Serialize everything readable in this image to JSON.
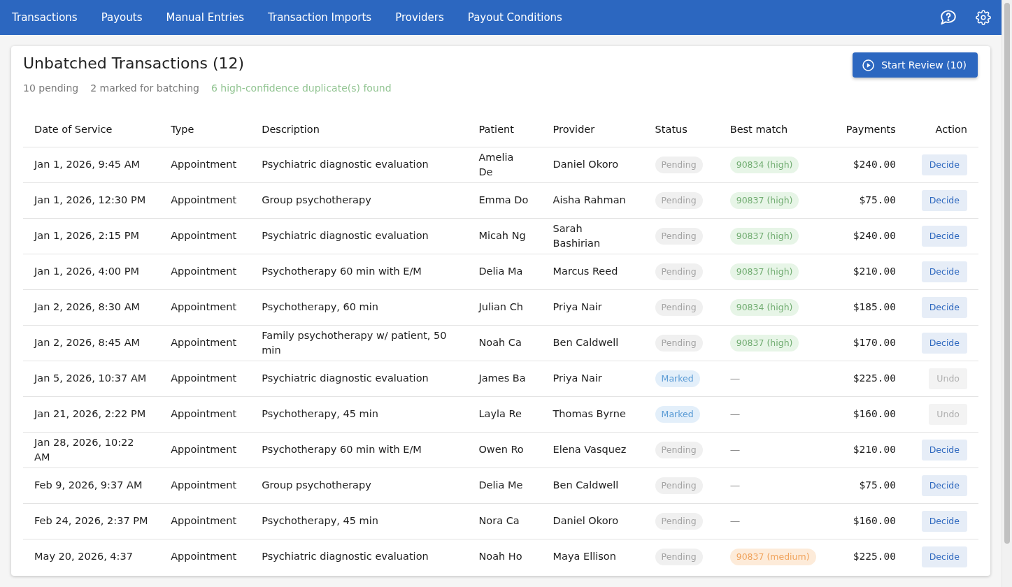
{
  "nav_links": [
    "Transactions",
    "Payouts",
    "Manual Entries",
    "Transaction Imports",
    "Providers",
    "Payout Conditions"
  ],
  "panel": {
    "title": "Unbatched Transactions (12)",
    "stats": [
      {
        "text": "10 pending",
        "kind": "muted"
      },
      {
        "text": "2 marked for batching",
        "kind": "muted"
      },
      {
        "text": "6 high-confidence duplicate(s) found",
        "kind": "success"
      }
    ],
    "review_button": "Start Review (10)"
  },
  "table": {
    "columns": [
      "Date of Service",
      "Type",
      "Description",
      "Patient",
      "Provider",
      "Status",
      "Best match",
      "Payments",
      "Action"
    ],
    "rows": [
      {
        "date_of_service": "Jan 1, 2026, 9:45 AM",
        "type": "Appointment",
        "description": "Psychiatric diagnostic evaluation",
        "patient": "Amelia De",
        "provider": "Daniel Okoro",
        "status": {
          "label": "Pending",
          "kind": "pending"
        },
        "best_match": {
          "label": "90834 (high)",
          "kind": "high"
        },
        "payments": "$240.00",
        "action": {
          "label": "Decide",
          "kind": "decide"
        }
      },
      {
        "date_of_service": "Jan 1, 2026, 12:30 PM",
        "type": "Appointment",
        "description": "Group psychotherapy",
        "patient": "Emma Do",
        "provider": "Aisha Rahman",
        "status": {
          "label": "Pending",
          "kind": "pending"
        },
        "best_match": {
          "label": "90837 (high)",
          "kind": "high"
        },
        "payments": "$75.00",
        "action": {
          "label": "Decide",
          "kind": "decide"
        }
      },
      {
        "date_of_service": "Jan 1, 2026, 2:15 PM",
        "type": "Appointment",
        "description": "Psychiatric diagnostic evaluation",
        "patient": "Micah Ng",
        "provider": "Sarah Bashirian",
        "status": {
          "label": "Pending",
          "kind": "pending"
        },
        "best_match": {
          "label": "90837 (high)",
          "kind": "high"
        },
        "payments": "$240.00",
        "action": {
          "label": "Decide",
          "kind": "decide"
        }
      },
      {
        "date_of_service": "Jan 1, 2026, 4:00 PM",
        "type": "Appointment",
        "description": "Psychotherapy 60 min with E/M",
        "patient": "Delia Ma",
        "provider": "Marcus Reed",
        "status": {
          "label": "Pending",
          "kind": "pending"
        },
        "best_match": {
          "label": "90837 (high)",
          "kind": "high"
        },
        "payments": "$210.00",
        "action": {
          "label": "Decide",
          "kind": "decide"
        }
      },
      {
        "date_of_service": "Jan 2, 2026, 8:30 AM",
        "type": "Appointment",
        "description": "Psychotherapy, 60 min",
        "patient": "Julian Ch",
        "provider": "Priya Nair",
        "status": {
          "label": "Pending",
          "kind": "pending"
        },
        "best_match": {
          "label": "90834 (high)",
          "kind": "high"
        },
        "payments": "$185.00",
        "action": {
          "label": "Decide",
          "kind": "decide"
        }
      },
      {
        "date_of_service": "Jan 2, 2026, 8:45 AM",
        "type": "Appointment",
        "description": "Family psychotherapy w/ patient, 50 min",
        "patient": "Noah Ca",
        "provider": "Ben Caldwell",
        "status": {
          "label": "Pending",
          "kind": "pending"
        },
        "best_match": {
          "label": "90837 (high)",
          "kind": "high"
        },
        "payments": "$170.00",
        "action": {
          "label": "Decide",
          "kind": "decide"
        }
      },
      {
        "date_of_service": "Jan 5, 2026, 10:37 AM",
        "type": "Appointment",
        "description": "Psychiatric diagnostic evaluation",
        "patient": "James Ba",
        "provider": "Priya Nair",
        "status": {
          "label": "Marked",
          "kind": "marked"
        },
        "best_match": {
          "label": "—",
          "kind": "none"
        },
        "payments": "$225.00",
        "action": {
          "label": "Undo",
          "kind": "undo"
        }
      },
      {
        "date_of_service": "Jan 21, 2026, 2:22 PM",
        "type": "Appointment",
        "description": "Psychotherapy, 45 min",
        "patient": "Layla Re",
        "provider": "Thomas Byrne",
        "status": {
          "label": "Marked",
          "kind": "marked"
        },
        "best_match": {
          "label": "—",
          "kind": "none"
        },
        "payments": "$160.00",
        "action": {
          "label": "Undo",
          "kind": "undo"
        }
      },
      {
        "date_of_service": "Jan 28, 2026, 10:22 AM",
        "type": "Appointment",
        "description": "Psychotherapy 60 min with E/M",
        "patient": "Owen Ro",
        "provider": "Elena Vasquez",
        "status": {
          "label": "Pending",
          "kind": "pending"
        },
        "best_match": {
          "label": "—",
          "kind": "none"
        },
        "payments": "$210.00",
        "action": {
          "label": "Decide",
          "kind": "decide"
        }
      },
      {
        "date_of_service": "Feb 9, 2026, 9:37 AM",
        "type": "Appointment",
        "description": "Group psychotherapy",
        "patient": "Delia Me",
        "provider": "Ben Caldwell",
        "status": {
          "label": "Pending",
          "kind": "pending"
        },
        "best_match": {
          "label": "—",
          "kind": "none"
        },
        "payments": "$75.00",
        "action": {
          "label": "Decide",
          "kind": "decide"
        }
      },
      {
        "date_of_service": "Feb 24, 2026, 2:37 PM",
        "type": "Appointment",
        "description": "Psychotherapy, 45 min",
        "patient": "Nora Ca",
        "provider": "Daniel Okoro",
        "status": {
          "label": "Pending",
          "kind": "pending"
        },
        "best_match": {
          "label": "—",
          "kind": "none"
        },
        "payments": "$160.00",
        "action": {
          "label": "Decide",
          "kind": "decide"
        }
      },
      {
        "date_of_service": "May 20, 2026, 4:37",
        "type": "Appointment",
        "description": "Psychiatric diagnostic evaluation",
        "patient": "Noah Ho",
        "provider": "Maya Ellison",
        "status": {
          "label": "Pending",
          "kind": "pending"
        },
        "best_match": {
          "label": "90837 (medium)",
          "kind": "medium"
        },
        "payments": "$225.00",
        "action": {
          "label": "Decide",
          "kind": "decide"
        }
      }
    ]
  }
}
